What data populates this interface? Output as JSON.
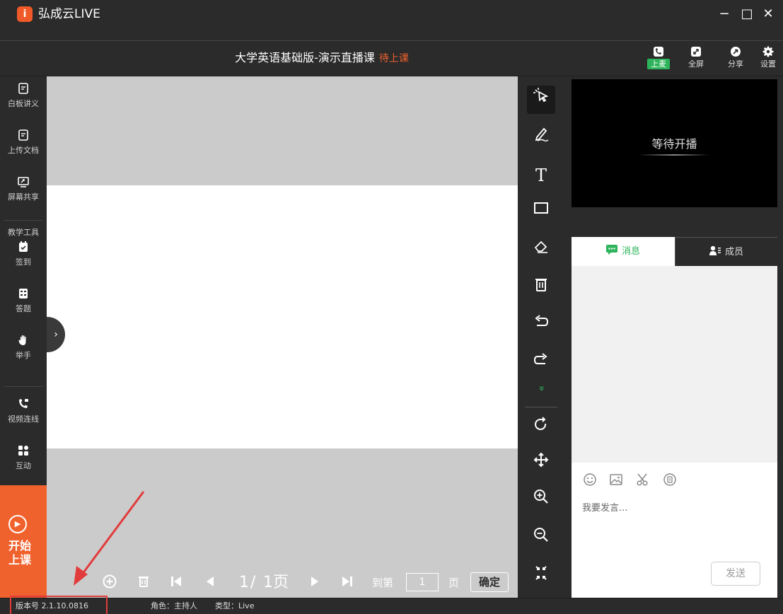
{
  "window": {
    "app_name": "弘成云LIVE",
    "logo_glyph": "i",
    "minimize": "−",
    "maximize": "□",
    "close": "✕"
  },
  "header": {
    "course_name": "大学英语基础版-演示直播课",
    "status": "待上课",
    "buttons": [
      {
        "label": "上麦",
        "icon": "phone-video-icon"
      },
      {
        "label": "全屏",
        "icon": "fullscreen-icon"
      },
      {
        "label": "分享",
        "icon": "share-icon"
      },
      {
        "label": "设置",
        "icon": "gear-icon"
      }
    ]
  },
  "sidebar": {
    "items": [
      {
        "label": "白板讲义",
        "icon": "whiteboard-icon"
      },
      {
        "label": "上传文档",
        "icon": "document-icon"
      },
      {
        "label": "屏幕共享",
        "icon": "screen-share-icon"
      }
    ],
    "section_label": "教学工具",
    "tools": [
      {
        "label": "签到",
        "icon": "checkin-icon"
      },
      {
        "label": "答题",
        "icon": "quiz-icon"
      },
      {
        "label": "举手",
        "icon": "raise-hand-icon"
      }
    ],
    "extras": [
      {
        "label": "视频连线",
        "icon": "video-call-icon"
      },
      {
        "label": "互动",
        "icon": "interaction-icon"
      }
    ],
    "start_button": "开始上课"
  },
  "board": {
    "expand_glyph": "›"
  },
  "pager": {
    "current": "1",
    "separator": "/",
    "total": "1页",
    "goto_label": "到第",
    "goto_value": "1",
    "unit": "页",
    "confirm": "确定"
  },
  "tools": {
    "more_glyph": "»"
  },
  "right_panel": {
    "video_placeholder": "等待开播",
    "tabs": [
      {
        "label": "消息",
        "icon": "chat-icon",
        "active": true
      },
      {
        "label": "成员",
        "icon": "members-icon",
        "active": false
      }
    ],
    "input_placeholder": "我要发言...",
    "send": "发送"
  },
  "statusbar": {
    "version": "版本号 2.1.10.0816",
    "role": "角色：主持人",
    "type": "类型：Live"
  },
  "colors": {
    "accent_orange": "#f0622d",
    "accent_green": "#2db45a",
    "highlight_red": "#e23b3b",
    "dark_bg": "#2b2b2b"
  }
}
